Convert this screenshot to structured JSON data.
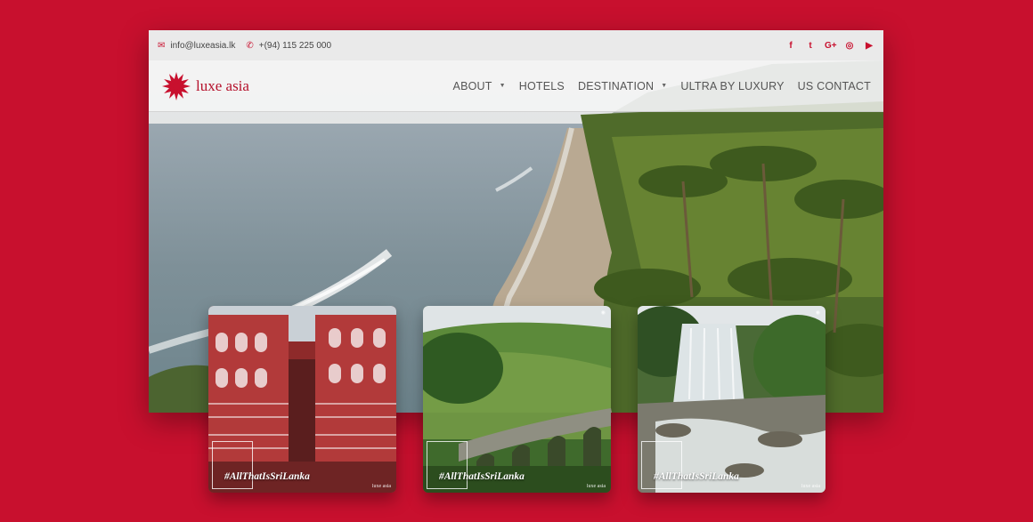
{
  "topbar": {
    "email": "info@luxeasia.lk",
    "phone": "+(94) 115 225 000",
    "socials": [
      "facebook-icon",
      "twitter-icon",
      "google-plus-icon",
      "instagram-icon",
      "youtube-icon"
    ],
    "social_glyphs": [
      "f",
      "t",
      "G+",
      "◎",
      "▶"
    ]
  },
  "logo": {
    "text": "luxe asia"
  },
  "nav": [
    {
      "label": "ABOUT",
      "dropdown": true
    },
    {
      "label": "HOTELS",
      "dropdown": false
    },
    {
      "label": "DESTINATION",
      "dropdown": true
    },
    {
      "label": "ULTRA BY LUXURY",
      "dropdown": false
    },
    {
      "label": "US CONTACT",
      "dropdown": false
    }
  ],
  "cards": [
    {
      "hashtag": "#AllThatIsSriLanka",
      "brand": "luxe asia",
      "scene": "red-mosque"
    },
    {
      "hashtag": "#AllThatIsSriLanka",
      "brand": "luxe asia",
      "scene": "nine-arch-bridge"
    },
    {
      "hashtag": "#AllThatIsSriLanka",
      "brand": "luxe asia",
      "scene": "waterfall"
    }
  ],
  "colors": {
    "brand_red": "#c8102e",
    "background": "#c8102e"
  }
}
